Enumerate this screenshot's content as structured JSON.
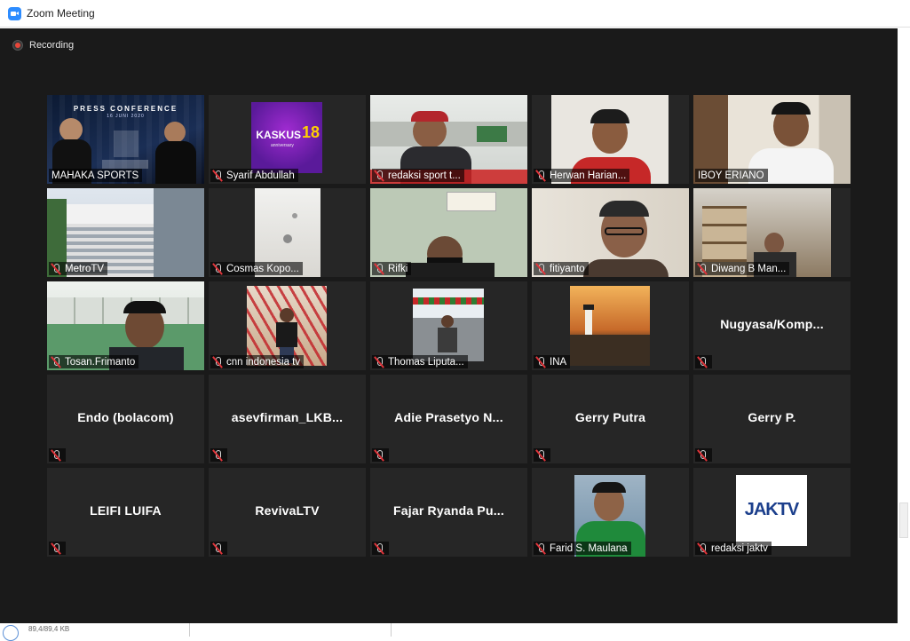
{
  "window": {
    "title": "Zoom Meeting"
  },
  "recording": {
    "label": "Recording"
  },
  "participants": [
    {
      "name": "MAHAKA SPORTS",
      "display": "",
      "video": "press-conference",
      "mic_muted": false,
      "active": true
    },
    {
      "name": "Syarif Abdullah",
      "display": "",
      "video": "kaskus-logo",
      "mic_muted": true
    },
    {
      "name": "redaksi sport t...",
      "display": "",
      "video": "newsroom",
      "mic_muted": true
    },
    {
      "name": "Herwan Harian...",
      "display": "",
      "video": "man-red-shirt",
      "mic_muted": true
    },
    {
      "name": "IBOY ERIANO",
      "display": "",
      "video": "man-white-shirt",
      "mic_muted": false
    },
    {
      "name": "MetroTV",
      "display": "",
      "video": "building",
      "mic_muted": true
    },
    {
      "name": "Cosmas Kopo...",
      "display": "",
      "video": "ceiling",
      "mic_muted": true
    },
    {
      "name": "Rifki",
      "display": "",
      "video": "man-mask",
      "mic_muted": true
    },
    {
      "name": "fitiyanto",
      "display": "",
      "video": "man-glasses",
      "mic_muted": true
    },
    {
      "name": "Diwang B Man...",
      "display": "",
      "video": "room-shelf",
      "mic_muted": true
    },
    {
      "name": "Tosan.Frimanto",
      "display": "",
      "video": "man-office",
      "mic_muted": true
    },
    {
      "name": "cnn indonesia tv",
      "display": "",
      "video": "red-bridge",
      "mic_muted": true
    },
    {
      "name": "Thomas Liputa...",
      "display": "",
      "video": "stadium",
      "mic_muted": true
    },
    {
      "name": "INA",
      "display": "",
      "video": "lighthouse",
      "mic_muted": true
    },
    {
      "name": "",
      "display": "Nugyasa/Komp...",
      "video": "",
      "mic_muted": true
    },
    {
      "name": "",
      "display": "Endo (bolacom)",
      "video": "",
      "mic_muted": true
    },
    {
      "name": "",
      "display": "asevfirman_LKB...",
      "video": "",
      "mic_muted": true
    },
    {
      "name": "",
      "display": "Adie Prasetyo N...",
      "video": "",
      "mic_muted": true
    },
    {
      "name": "",
      "display": "Gerry Putra",
      "video": "",
      "mic_muted": true
    },
    {
      "name": "",
      "display": "Gerry P.",
      "video": "",
      "mic_muted": true
    },
    {
      "name": "",
      "display": "LEIFI LUIFA",
      "video": "",
      "mic_muted": true
    },
    {
      "name": "",
      "display": "RevivaLTV",
      "video": "",
      "mic_muted": true
    },
    {
      "name": "",
      "display": "Fajar Ryanda Pu...",
      "video": "",
      "mic_muted": true
    },
    {
      "name": "Farid S. Maulana",
      "display": "",
      "video": "man-green",
      "mic_muted": true
    },
    {
      "name": "redaksi jaktv",
      "display": "",
      "video": "jaktv-logo",
      "mic_muted": true
    }
  ],
  "press_conference": {
    "heading": "PRESS CONFERENCE",
    "date": "16 JUNI 2020"
  },
  "kaskus": {
    "word": "KASKUS",
    "number": "18",
    "sub": "anniversary"
  },
  "jaktv": {
    "logo": "JAKTV"
  },
  "footer": {
    "size": "89,4/89,4 KB"
  },
  "colors": {
    "active_speaker": "#d9e86c",
    "muted_red": "#e0343a",
    "tile_bg": "#262626",
    "meeting_bg": "#1a1a1a"
  }
}
